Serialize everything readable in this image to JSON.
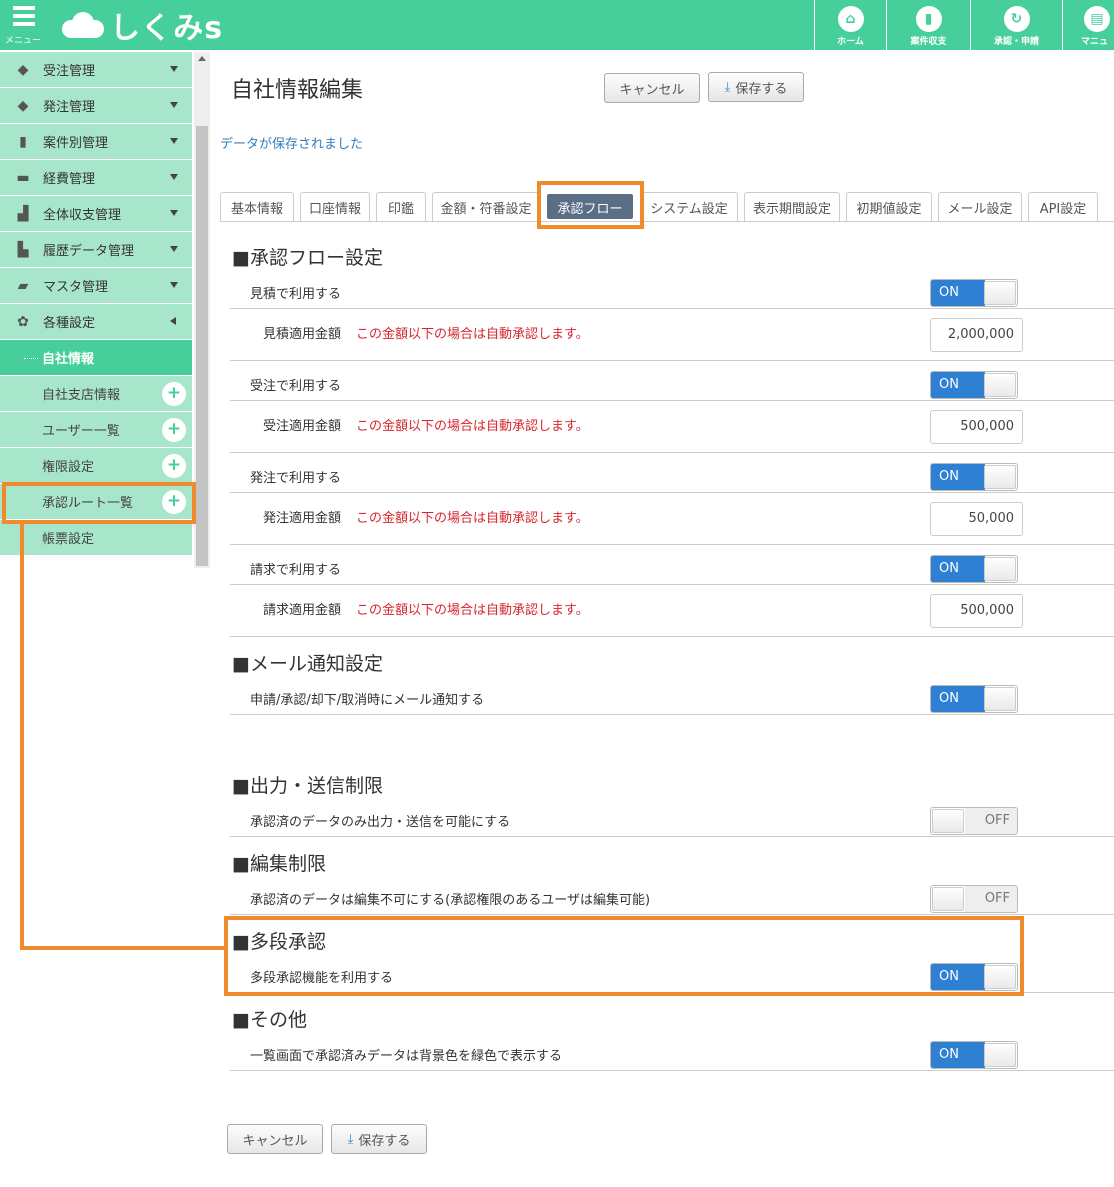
{
  "header": {
    "menu_label": "メニュー",
    "logo_text": "しくみs",
    "nav": [
      {
        "label": "ホーム",
        "icon": "home-icon"
      },
      {
        "label": "案件収支",
        "icon": "bar-chart-icon"
      },
      {
        "label": "承認・申請",
        "icon": "refresh-icon"
      },
      {
        "label": "マニュ",
        "icon": "book-icon"
      }
    ],
    "accent_color": "#47cf9b"
  },
  "sidebar": {
    "items": [
      {
        "label": "受注管理",
        "icon": "tag-icon"
      },
      {
        "label": "発注管理",
        "icon": "tag-icon"
      },
      {
        "label": "案件別管理",
        "icon": "bar-chart-icon"
      },
      {
        "label": "経費管理",
        "icon": "credit-card-icon"
      },
      {
        "label": "全体収支管理",
        "icon": "signal-icon"
      },
      {
        "label": "履歴データ管理",
        "icon": "file-icon"
      },
      {
        "label": "マスタ管理",
        "icon": "folder-icon"
      },
      {
        "label": "各種設定",
        "icon": "gear-icon"
      }
    ],
    "sub_items": [
      {
        "label": "自社情報"
      },
      {
        "label": "自社支店情報"
      },
      {
        "label": "ユーザー一覧"
      },
      {
        "label": "権限設定"
      },
      {
        "label": "承認ルート一覧"
      },
      {
        "label": "帳票設定"
      }
    ]
  },
  "main": {
    "title": "自社情報編集",
    "cancel_label": "キャンセル",
    "save_label": "保存する",
    "saved_message": "データが保存されました",
    "tabs": [
      "基本情報",
      "口座情報",
      "印鑑",
      "金額・符番設定",
      "承認フロー",
      "システム設定",
      "表示期間設定",
      "初期値設定",
      "メール設定",
      "API設定"
    ],
    "active_tab": "承認フロー",
    "sections": {
      "approval_flow": {
        "title": "■承認フロー設定",
        "note": "この金額以下の場合は自動承認します。",
        "rows": [
          {
            "label": "見積で利用する",
            "toggle": "ON",
            "amount_label": "見積適用金額",
            "amount": "2,000,000"
          },
          {
            "label": "受注で利用する",
            "toggle": "ON",
            "amount_label": "受注適用金額",
            "amount": "500,000"
          },
          {
            "label": "発注で利用する",
            "toggle": "ON",
            "amount_label": "発注適用金額",
            "amount": "50,000"
          },
          {
            "label": "請求で利用する",
            "toggle": "ON",
            "amount_label": "請求適用金額",
            "amount": "500,000"
          }
        ]
      },
      "mail": {
        "title": "■メール通知設定",
        "label": "申請/承認/却下/取消時にメール通知する",
        "toggle": "ON"
      },
      "output": {
        "title": "■出力・送信制限",
        "label": "承認済のデータのみ出力・送信を可能にする",
        "toggle": "OFF"
      },
      "edit": {
        "title": "■編集制限",
        "label": "承認済のデータは編集不可にする(承認権限のあるユーザは編集可能)",
        "toggle": "OFF"
      },
      "multi": {
        "title": "■多段承認",
        "label": "多段承認機能を利用する",
        "toggle": "ON"
      },
      "other": {
        "title": "■その他",
        "label": "一覧画面で承認済みデータは背景色を緑色で表示する",
        "toggle": "ON"
      }
    },
    "toggle_on_text": "ON",
    "toggle_off_text": "OFF",
    "toggle_on_color": "#2f7fd3",
    "note_color": "#d6262e",
    "highlight_color": "#f08a2c"
  }
}
